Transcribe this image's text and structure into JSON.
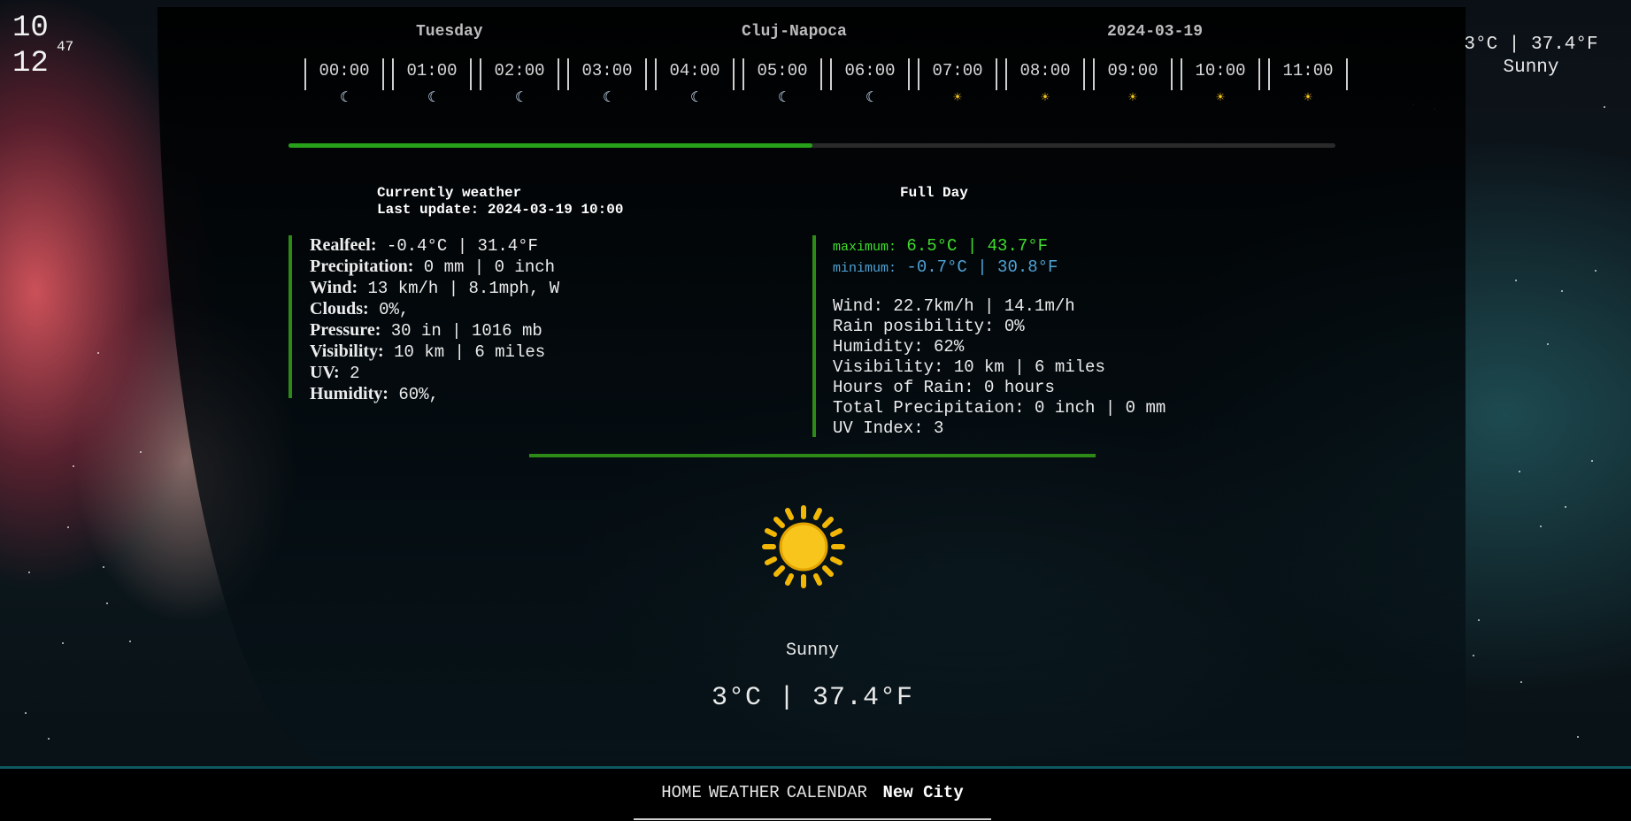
{
  "clock": {
    "hours": "10",
    "minutes": "12",
    "seconds": "47"
  },
  "top_right": {
    "temp": "3°C | 37.4°F",
    "condition": "Sunny"
  },
  "header": {
    "day": "Tuesday",
    "city": "Cluj-Napoca",
    "date": "2024-03-19"
  },
  "hourly": [
    {
      "time": "00:00",
      "icon": "moon-icon"
    },
    {
      "time": "01:00",
      "icon": "moon-icon"
    },
    {
      "time": "02:00",
      "icon": "moon-icon"
    },
    {
      "time": "03:00",
      "icon": "moon-icon"
    },
    {
      "time": "04:00",
      "icon": "moon-icon"
    },
    {
      "time": "05:00",
      "icon": "moon-icon"
    },
    {
      "time": "06:00",
      "icon": "moon-icon"
    },
    {
      "time": "07:00",
      "icon": "sun-icon"
    },
    {
      "time": "08:00",
      "icon": "sun-icon"
    },
    {
      "time": "09:00",
      "icon": "sun-icon"
    },
    {
      "time": "10:00",
      "icon": "sun-icon"
    },
    {
      "time": "11:00",
      "icon": "sun-icon"
    }
  ],
  "day_progress": 0.5,
  "current": {
    "title": "Currently weather",
    "last_update": "Last update: 2024-03-19 10:00",
    "realfeel_label": "Realfeel:",
    "realfeel": "-0.4°C | 31.4°F",
    "precip_label": "Precipitation:",
    "precip": "0 mm | 0 inch",
    "wind_label": "Wind:",
    "wind": "13 km/h | 8.1mph, W",
    "clouds_label": "Clouds:",
    "clouds": "0%,",
    "pressure_label": "Pressure:",
    "pressure": "30 in | 1016 mb",
    "visibility_label": "Visibility:",
    "visibility": "10 km | 6 miles",
    "uv_label": "UV:",
    "uv": "2",
    "humidity_label": "Humidity:",
    "humidity": "60%,"
  },
  "full_day": {
    "title": "Full Day",
    "max_label": "maximum:",
    "max": "6.5°C | 43.7°F",
    "min_label": "minimum:",
    "min": "-0.7°C | 30.8°F",
    "wind": "Wind: 22.7km/h | 14.1m/h",
    "rain": "Rain posibility: 0%",
    "humidity": "Humidity: 62%",
    "visibility": "Visibility: 10 km | 6 miles",
    "hours_rain": "Hours of Rain: 0 hours",
    "total_precip": "Total Precipitaion: 0 inch | 0 mm",
    "uv": "UV Index: 3"
  },
  "main": {
    "icon": "sun-icon",
    "condition": "Sunny",
    "temp": "3°C | 37.4°F"
  },
  "nav": {
    "home": "HOME",
    "weather": "WEATHER",
    "calendar": "CALENDAR",
    "new_city": "New City"
  },
  "colors": {
    "accent": "#2d8a17",
    "max": "#3fdd2b",
    "min": "#4fa3d6",
    "sun": "#f7c51b"
  }
}
